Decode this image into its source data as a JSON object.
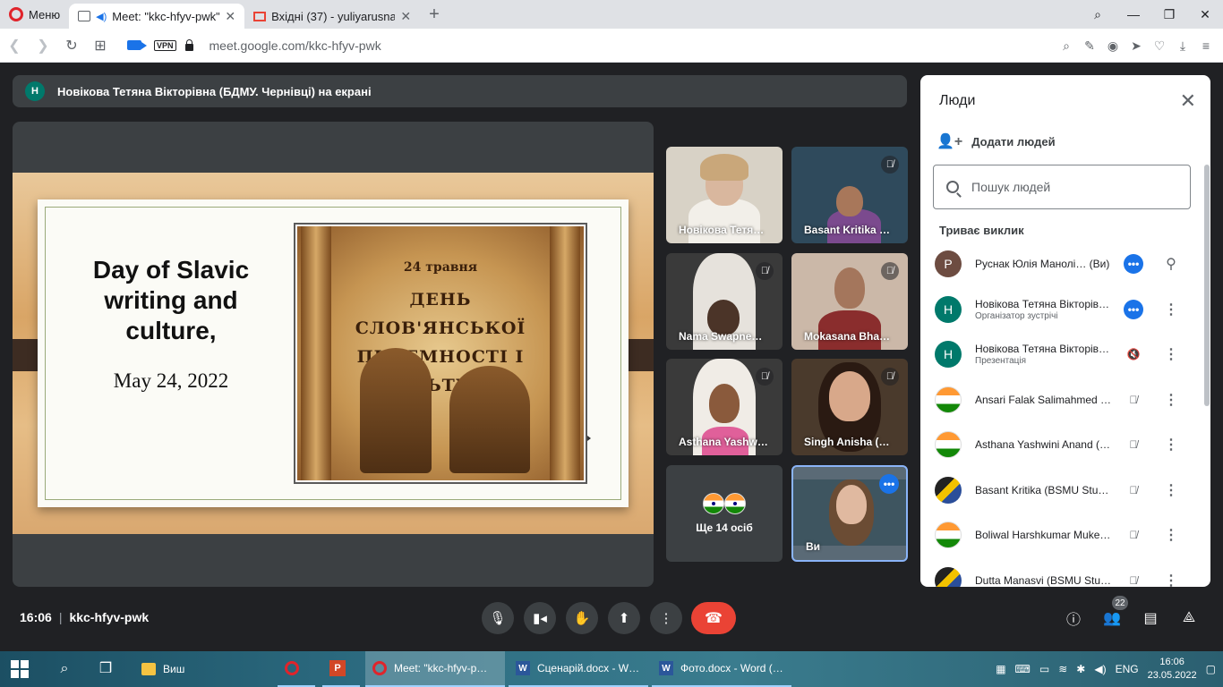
{
  "browser": {
    "menu_label": "Меню",
    "tabs": [
      {
        "title": "Meet: \"kkc-hfyv-pwk\"",
        "active": true
      },
      {
        "title": "Вхідні (37) - yuliyarusnak@",
        "active": false
      }
    ],
    "new_tab_label": "+",
    "url": "meet.google.com/kkc-hfyv-pwk",
    "vpn_label": "VPN"
  },
  "banner": {
    "avatar_letter": "Н",
    "text": "Новікова Тетяна Вікторівна (БДМУ. Чернівці) на екрані"
  },
  "slide": {
    "title": "Day of Slavic writing and culture,",
    "date": "May 24, 2022",
    "scroll_date": "24 травня",
    "scroll_title": "ДЕНЬ СЛОВ'ЯНСЬКОЇ ПИСЕМНОСТІ І КУЛЬТУРИ"
  },
  "tiles": [
    {
      "name": "Новікова Тетя…",
      "muted": false
    },
    {
      "name": "Basant Kritika …",
      "muted": true
    },
    {
      "name": "Nama Swapne…",
      "muted": true
    },
    {
      "name": "Mokasana Bha…",
      "muted": true
    },
    {
      "name": "Asthana Yashw…",
      "muted": true
    },
    {
      "name": "Singh Anisha (…",
      "muted": true
    },
    {
      "name": "Ще 14 осіб",
      "muted": false
    },
    {
      "name": "Ви",
      "muted": false
    }
  ],
  "panel": {
    "title": "Люди",
    "add_people": "Додати людей",
    "search_placeholder": "Пошук людей",
    "section": "Триває виклик",
    "participants": [
      {
        "avatar": "Р",
        "color": "#6d4c41",
        "name": "Руснак Юлія Манолі… (Ви)",
        "role": ""
      },
      {
        "avatar": "Н",
        "color": "#00796b",
        "name": "Новікова Тетяна Вікторів…",
        "role": "Організатор зустрічі"
      },
      {
        "avatar": "Н",
        "color": "#00796b",
        "name": "Новікова Тетяна Вікторів…",
        "role": "Презентація"
      },
      {
        "avatar": "",
        "color": "flag",
        "name": "Ansari Falak Salimahmed …",
        "role": ""
      },
      {
        "avatar": "",
        "color": "flag",
        "name": "Asthana Yashwini Anand (…",
        "role": ""
      },
      {
        "avatar": "",
        "color": "mixed",
        "name": "Basant Kritika (BSMU Stu…",
        "role": ""
      },
      {
        "avatar": "",
        "color": "flag",
        "name": "Boliwal Harshkumar Muke…",
        "role": ""
      },
      {
        "avatar": "",
        "color": "mixed",
        "name": "Dutta Manasvi (BSMU Stu…",
        "role": ""
      }
    ]
  },
  "meetbar": {
    "time": "16:06",
    "separator": "|",
    "code": "kkc-hfyv-pwk",
    "people_count": "22"
  },
  "taskbar": {
    "apps": [
      {
        "label": "Виш",
        "active": false
      },
      {
        "label": "Meet: \"kkc-hfyv-p…",
        "active": true
      },
      {
        "label": "Сценарій.docx - W…",
        "active": false
      },
      {
        "label": "Фото.docx - Word (…",
        "active": false
      }
    ],
    "lang": "ENG",
    "time": "16:06",
    "date": "23.05.2022"
  },
  "colors": {
    "meet_bg": "#202124",
    "tile_bg": "#3c4043",
    "hangup": "#ea4335",
    "accent_blue": "#1a73e8"
  }
}
